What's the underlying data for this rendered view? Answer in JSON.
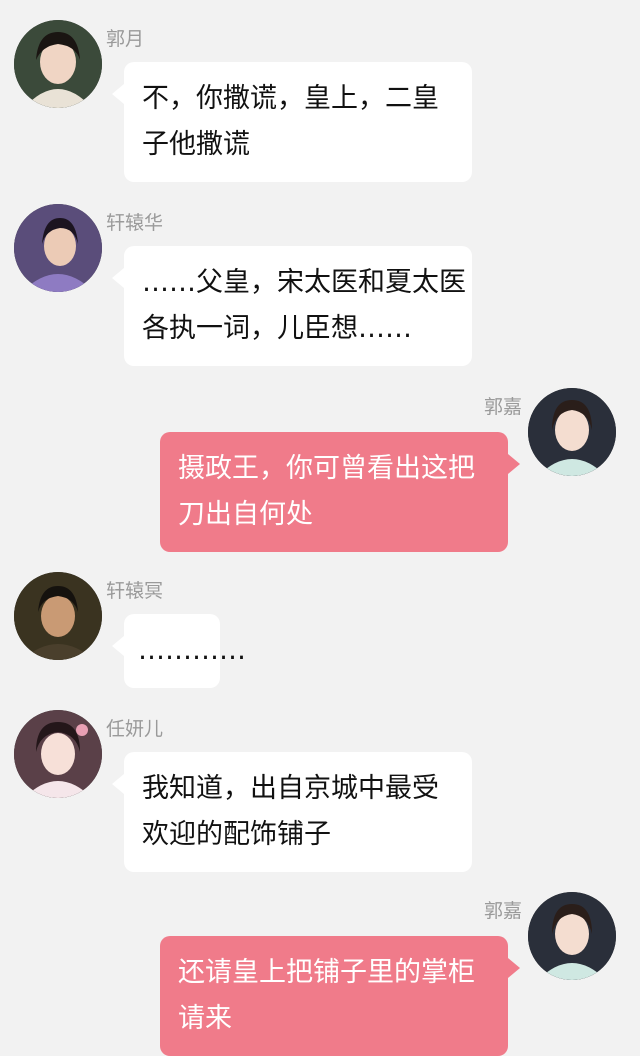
{
  "messages": [
    {
      "speaker": "郭月",
      "side": "left",
      "lines": [
        "不，你撒谎，皇上，二皇",
        "子他撒谎"
      ]
    },
    {
      "speaker": "轩辕华",
      "side": "left",
      "lines": [
        "……父皇，宋太医和夏太医",
        "各执一词，儿臣想……"
      ]
    },
    {
      "speaker": "郭嘉",
      "side": "right",
      "lines": [
        "摄政王，你可曾看出这把",
        "刀出自何处"
      ]
    },
    {
      "speaker": "轩辕冥",
      "side": "left",
      "lines": [
        "…………"
      ]
    },
    {
      "speaker": "任妍儿",
      "side": "left",
      "lines": [
        "我知道，出自京城中最受",
        "欢迎的配饰铺子"
      ]
    },
    {
      "speaker": "郭嘉",
      "side": "right",
      "lines": [
        "还请皇上把铺子里的掌柜",
        "请来"
      ]
    }
  ],
  "colors": {
    "background": "#f2f2f2",
    "left_bubble": "#ffffff",
    "right_bubble": "#f07b8a",
    "name_text": "#9a9a9a"
  },
  "avatar_icons": [
    "avatar-guoyue",
    "avatar-xuanyuanhua",
    "avatar-guojia",
    "avatar-xuanyuanming",
    "avatar-renyaner",
    "avatar-guojia"
  ]
}
